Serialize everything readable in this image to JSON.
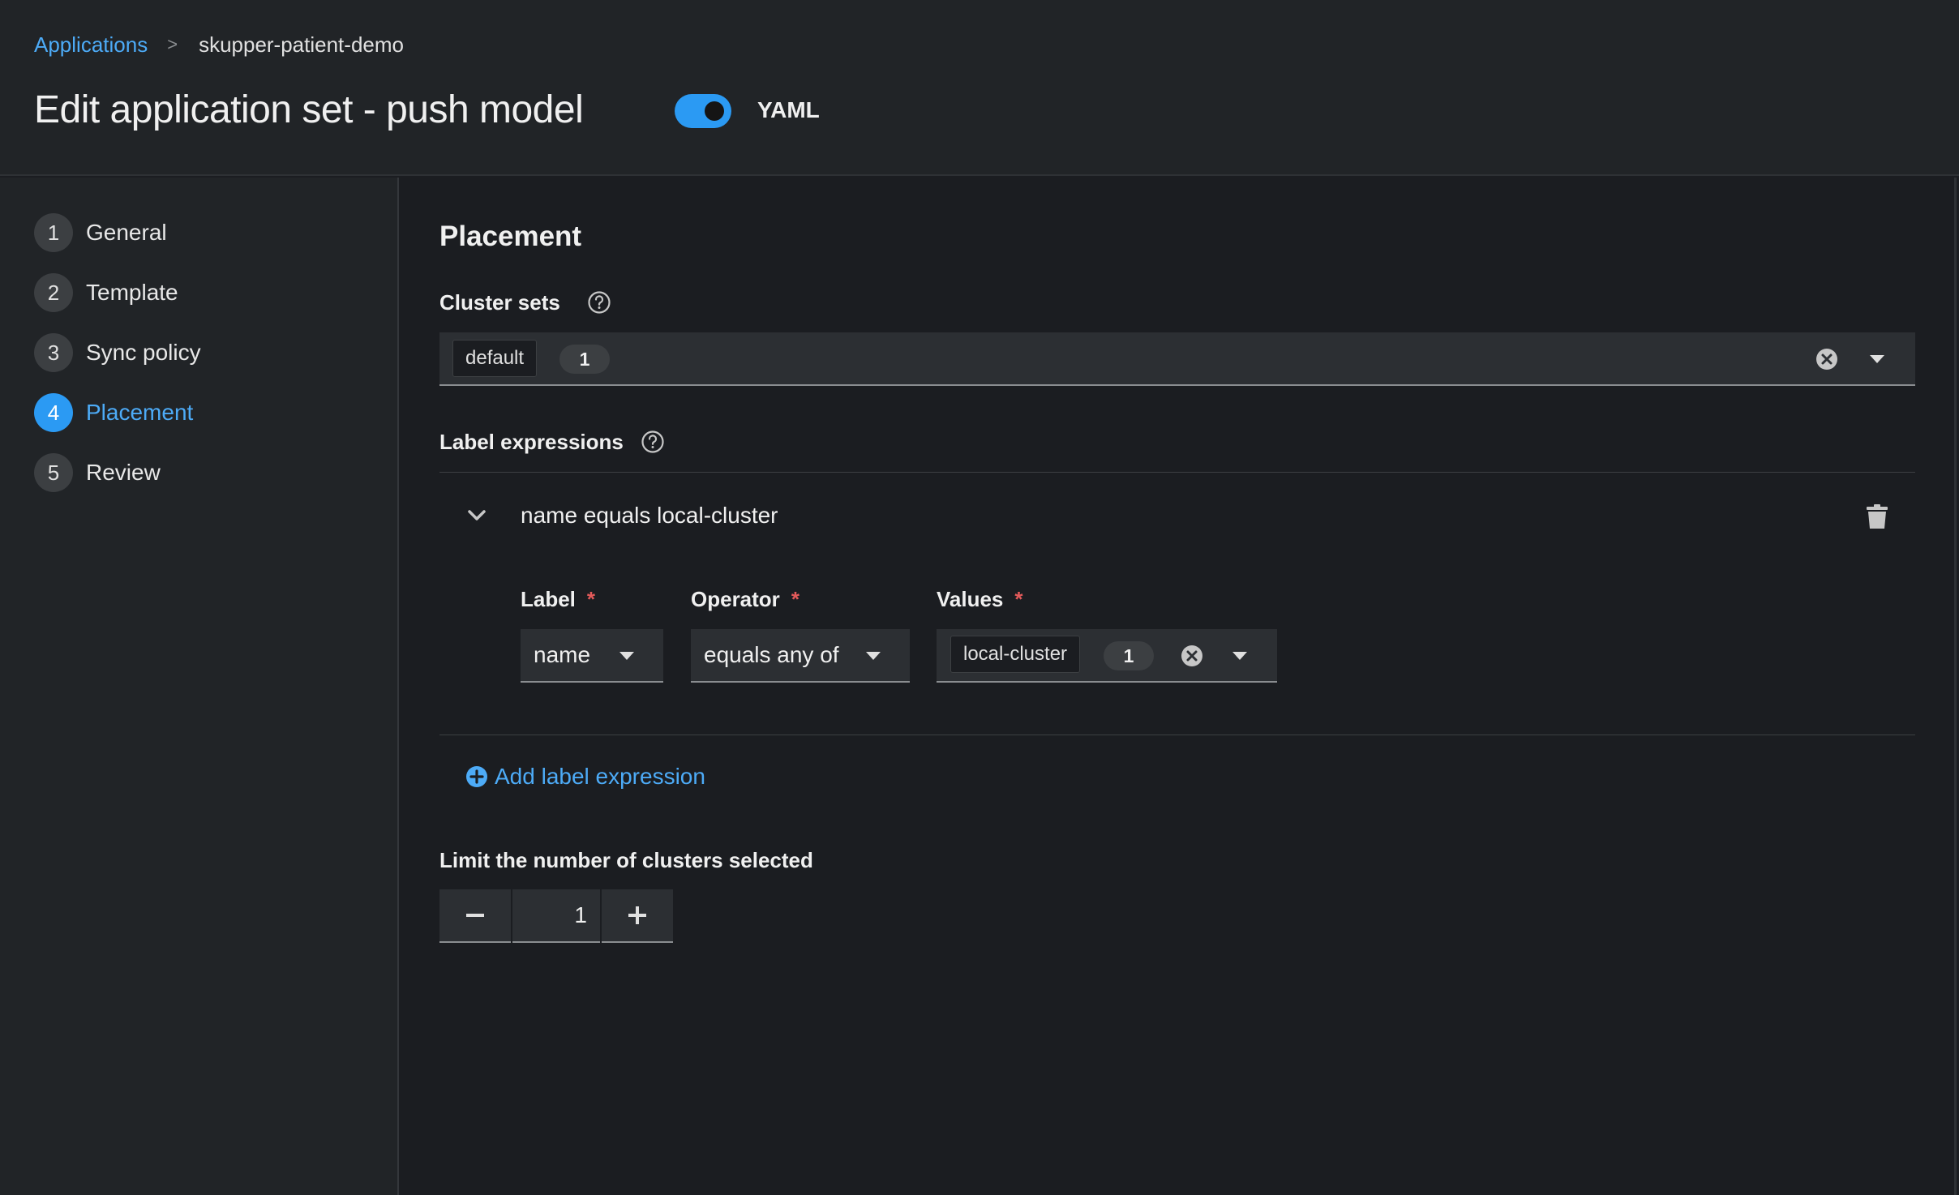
{
  "breadcrumb": {
    "parent": "Applications",
    "separator": ">",
    "current": "skupper-patient-demo"
  },
  "header": {
    "title": "Edit application set - push model",
    "yaml_toggle_label": "YAML",
    "yaml_enabled": true
  },
  "steps": [
    {
      "num": "1",
      "label": "General"
    },
    {
      "num": "2",
      "label": "Template"
    },
    {
      "num": "3",
      "label": "Sync policy"
    },
    {
      "num": "4",
      "label": "Placement"
    },
    {
      "num": "5",
      "label": "Review"
    }
  ],
  "active_step": "Placement",
  "placement": {
    "title": "Placement",
    "cluster_sets": {
      "label": "Cluster sets",
      "chip": "default",
      "count": "1"
    },
    "label_expressions": {
      "label": "Label expressions",
      "summary": "name equals local-cluster",
      "label_field": {
        "label": "Label",
        "required": "*",
        "value": "name"
      },
      "operator_field": {
        "label": "Operator",
        "required": "*",
        "value": "equals any of"
      },
      "values_field": {
        "label": "Values",
        "required": "*",
        "chip": "local-cluster",
        "count": "1"
      },
      "add_link": "Add label expression"
    },
    "limit": {
      "label": "Limit the number of clusters selected",
      "value": "1",
      "minus": "−",
      "plus": "+"
    }
  },
  "colors": {
    "accent": "#2b9af3",
    "link": "#4dabf7",
    "required": "#e35a5a",
    "background": "#1b1d21"
  }
}
